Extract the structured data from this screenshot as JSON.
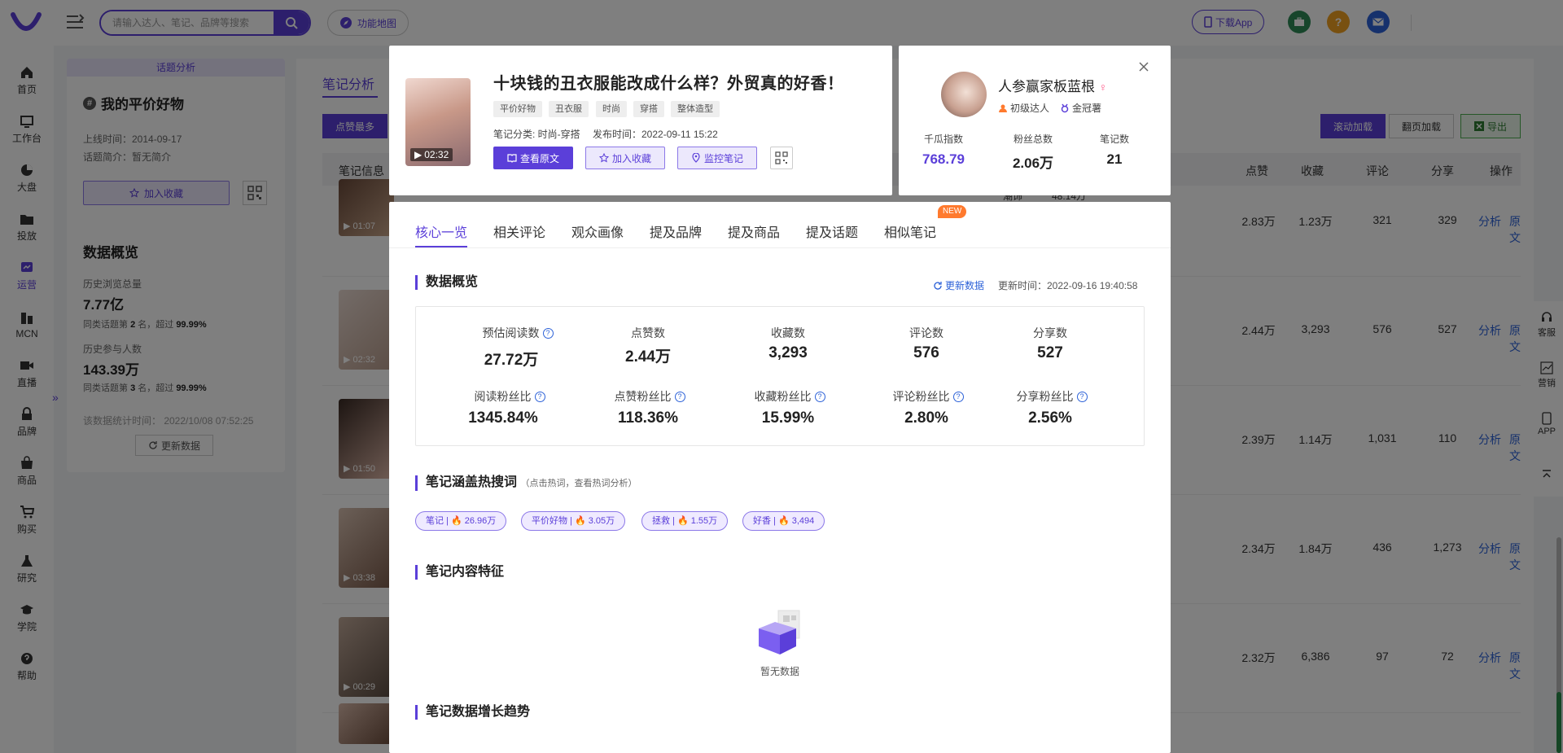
{
  "header": {
    "search_placeholder": "请输入达人、笔记、品牌等搜索",
    "func_map": "功能地图",
    "download_app": "下载App"
  },
  "sidebar": {
    "items": [
      {
        "label": "首页",
        "icon": "home-icon"
      },
      {
        "label": "工作台",
        "icon": "workbench-icon"
      },
      {
        "label": "大盘",
        "icon": "pie-chart-icon"
      },
      {
        "label": "投放",
        "icon": "folder-icon"
      },
      {
        "label": "运营",
        "icon": "operation-icon",
        "active": true
      },
      {
        "label": "MCN",
        "icon": "mcn-icon"
      },
      {
        "label": "直播",
        "icon": "video-icon"
      },
      {
        "label": "品牌",
        "icon": "brand-icon"
      },
      {
        "label": "商品",
        "icon": "bag-icon"
      },
      {
        "label": "购买",
        "icon": "cart-icon"
      },
      {
        "label": "研究",
        "icon": "flask-icon"
      },
      {
        "label": "学院",
        "icon": "graduation-icon"
      },
      {
        "label": "帮助",
        "icon": "help-icon"
      }
    ]
  },
  "topic": {
    "header": "话题分析",
    "name": "我的平价好物",
    "online_time": "上线时间：2014-09-17",
    "intro": "话题简介：暂无简介",
    "add_fav": "加入收藏",
    "overview_title": "数据概览",
    "hist_views_label": "历史浏览总量",
    "hist_views_value": "7.77亿",
    "hist_views_rank_pre": "同类话题第",
    "hist_views_rank": "2",
    "hist_views_rank_mid": "名，超过",
    "hist_views_pct": "99.99%",
    "hist_part_label": "历史参与人数",
    "hist_part_value": "143.39万",
    "hist_part_rank_pre": "同类话题第",
    "hist_part_rank": "3",
    "hist_part_rank_mid": "名，超过",
    "hist_part_pct": "99.99%",
    "stat_time": "该数据统计时间：  2022/10/08 07:52:25",
    "update_btn": "更新数据"
  },
  "main": {
    "tab": "笔记分析",
    "sort_btn": "点赞最多",
    "scroll_load": "滚动加载",
    "page_load": "翻页加载",
    "export": "导出",
    "columns": {
      "note_info": "笔记信息",
      "likes": "点赞",
      "favs": "收藏",
      "comments": "评论",
      "shares": "分享",
      "ops": "操作"
    },
    "partial_text_1": "潮饰",
    "partial_text_2": "48.14万",
    "rows": [
      {
        "duration": "01:07",
        "likes": "2.83万",
        "favs": "1.23万",
        "comments": "321",
        "shares": "329",
        "analyze": "分析",
        "source": "原文"
      },
      {
        "duration": "02:32",
        "likes": "2.44万",
        "favs": "3,293",
        "comments": "576",
        "shares": "527",
        "analyze": "分析",
        "source": "原文"
      },
      {
        "duration": "01:50",
        "likes": "2.39万",
        "favs": "1.14万",
        "comments": "1,031",
        "shares": "110",
        "analyze": "分析",
        "source": "原文"
      },
      {
        "duration": "03:38",
        "likes": "2.34万",
        "favs": "1.84万",
        "comments": "436",
        "shares": "1,273",
        "analyze": "分析",
        "source": "原文"
      },
      {
        "duration": "00:29",
        "likes": "2.32万",
        "favs": "6,386",
        "comments": "97",
        "shares": "72",
        "analyze": "分析",
        "source": "原文"
      }
    ]
  },
  "note": {
    "title": "十块钱的丑衣服能改成什么样？外贸真的好香！",
    "duration": "02:32",
    "tags": [
      "平价好物",
      "丑衣服",
      "时尚",
      "穿搭",
      "整体造型"
    ],
    "category": "笔记分类: 时尚-穿搭",
    "publish_time": "发布时间：2022-09-11 15:22",
    "view_source": "查看原文",
    "add_fav": "加入收藏",
    "monitor": "监控笔记"
  },
  "author": {
    "name": "人参赢家板蓝根",
    "level": "初级达人",
    "badge": "金冠薯",
    "stats": [
      {
        "label": "千瓜指数",
        "value": "768.79",
        "accent": true
      },
      {
        "label": "粉丝总数",
        "value": "2.06万"
      },
      {
        "label": "笔记数",
        "value": "21"
      }
    ]
  },
  "detail": {
    "tabs": [
      "核心一览",
      "相关评论",
      "观众画像",
      "提及品牌",
      "提及商品",
      "提及话题",
      "相似笔记"
    ],
    "new_badge": "NEW",
    "overview_title": "数据概览",
    "update_link": "更新数据",
    "update_time": "更新时间：2022-09-16 19:40:58",
    "metrics_row1": [
      {
        "label": "预估阅读数",
        "value": "27.72万",
        "help": true
      },
      {
        "label": "点赞数",
        "value": "2.44万"
      },
      {
        "label": "收藏数",
        "value": "3,293"
      },
      {
        "label": "评论数",
        "value": "576"
      },
      {
        "label": "分享数",
        "value": "527"
      }
    ],
    "metrics_row2": [
      {
        "label": "阅读粉丝比",
        "value": "1345.84%",
        "help": true
      },
      {
        "label": "点赞粉丝比",
        "value": "118.36%",
        "help": true
      },
      {
        "label": "收藏粉丝比",
        "value": "15.99%",
        "help": true
      },
      {
        "label": "评论粉丝比",
        "value": "2.80%",
        "help": true
      },
      {
        "label": "分享粉丝比",
        "value": "2.56%",
        "help": true
      }
    ],
    "hot_title": "笔记涵盖热搜词",
    "hot_note": "（点击热词，查看热词分析）",
    "hot_words": [
      {
        "word": "笔记",
        "count": "26.96万"
      },
      {
        "word": "平价好物",
        "count": "3.05万"
      },
      {
        "word": "拯救",
        "count": "1.55万"
      },
      {
        "word": "好香",
        "count": "3,494"
      }
    ],
    "content_title": "笔记内容特征",
    "empty_text": "暂无数据",
    "trend_title": "笔记数据增长趋势"
  },
  "right_float": {
    "service": "客服",
    "marketing": "营销",
    "app": "APP"
  },
  "colors": {
    "accent": "#5b3fd9",
    "link": "#2d62d8",
    "fire": "#ff4d4f"
  }
}
